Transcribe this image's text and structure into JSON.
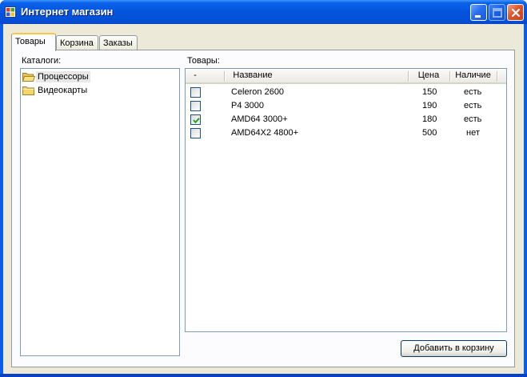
{
  "window": {
    "title": "Интернет магазин"
  },
  "tabs": [
    {
      "label": "Товары",
      "active": true
    },
    {
      "label": "Корзина",
      "active": false
    },
    {
      "label": "Заказы",
      "active": false
    }
  ],
  "catalogs": {
    "label": "Каталоги:",
    "items": [
      {
        "label": "Процессоры",
        "icon": "open-folder-icon",
        "selected": true
      },
      {
        "label": "Видеокарты",
        "icon": "folder-icon",
        "selected": false
      }
    ]
  },
  "products": {
    "label": "Товары:",
    "columns": [
      "-",
      "Название",
      "Цена",
      "Наличие"
    ],
    "rows": [
      {
        "checked": false,
        "name": "Celeron 2600",
        "price": "150",
        "stock": "есть"
      },
      {
        "checked": false,
        "name": "P4 3000",
        "price": "190",
        "stock": "есть"
      },
      {
        "checked": true,
        "name": "AMD64 3000+",
        "price": "180",
        "stock": "есть"
      },
      {
        "checked": false,
        "name": "AMD64X2 4800+",
        "price": "500",
        "stock": "нет"
      }
    ]
  },
  "actions": {
    "add_to_cart_label": "Добавить в корзину"
  },
  "colors": {
    "titlebar": "#0453dc",
    "face": "#ece9d8",
    "active_tab_accent": "#ffc83c",
    "checkmark": "#21a121"
  }
}
